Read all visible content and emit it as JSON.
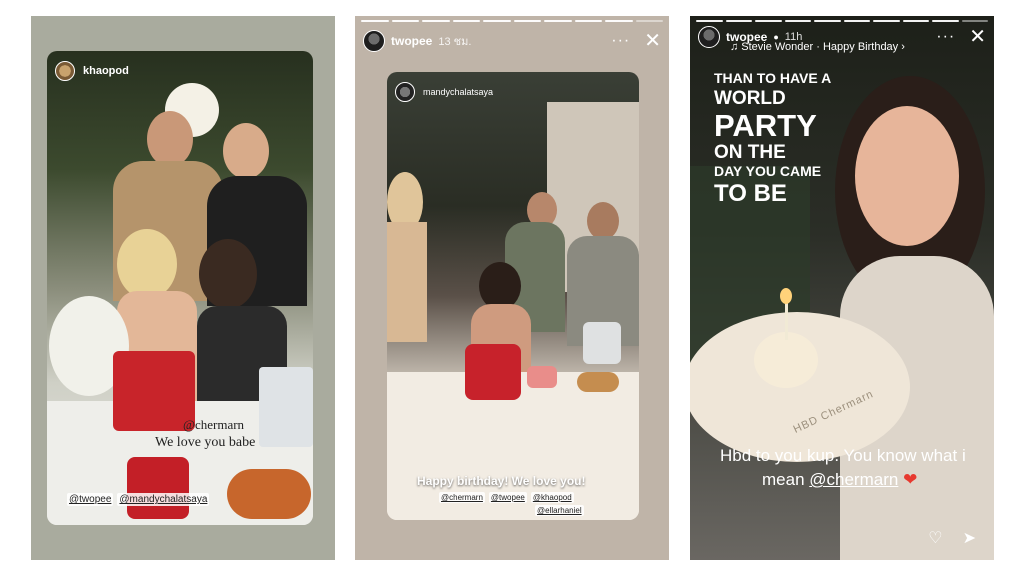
{
  "story1": {
    "frame_user": "khaopod",
    "caption_mention": "@chermarn",
    "caption_text": "We love you babe",
    "tags": [
      "@twopee",
      "@mandychalatsaya"
    ]
  },
  "story2": {
    "user": "twopee",
    "time": "13 ชม.",
    "frame_user": "mandychalatsaya",
    "caption_text": "Happy birthday! We love you!",
    "tags": [
      "@chermarn",
      "@twopee",
      "@khaopod"
    ],
    "tag_extra": "@ellarhaniel"
  },
  "story3": {
    "user": "twopee",
    "time": "11h",
    "music": "Stevie Wonder · Happy Birthday",
    "lyrics": [
      "THAN TO HAVE A",
      "WORLD",
      "PARTY",
      "ON THE",
      "DAY YOU CAME",
      "TO BE"
    ],
    "plate_text": "HBD Chermarn",
    "caption_line1": "Hbd to you kup. You know what i",
    "caption_line2_prefix": "mean",
    "caption_mention": "@chermarn"
  },
  "icons": {
    "more": "more-icon",
    "close": "close-icon",
    "heart": "heart-icon",
    "send": "send-icon",
    "music": "music-icon"
  }
}
